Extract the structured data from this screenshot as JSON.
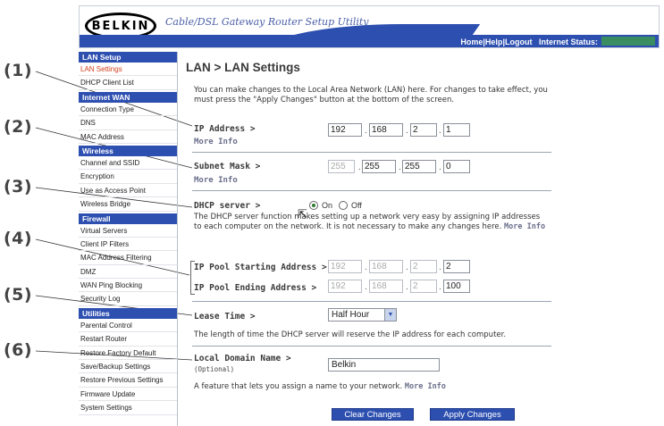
{
  "callouts": [
    "(1)",
    "(2)",
    "(3)",
    "(4)",
    "(5)",
    "(6)"
  ],
  "header": {
    "logo": "BELKIN",
    "title": "Cable/DSL Gateway Router Setup Utility",
    "links": {
      "home": "Home",
      "help": "Help",
      "logout": "Logout",
      "status": "Internet Status:"
    },
    "sep": "|"
  },
  "sidebar": {
    "lan_setup": {
      "title": "LAN Setup",
      "items": [
        "LAN Settings",
        "DHCP Client List"
      ]
    },
    "internet_wan": {
      "title": "Internet WAN",
      "items": [
        "Connection Type",
        "DNS",
        "MAC Address"
      ]
    },
    "wireless": {
      "title": "Wireless",
      "items": [
        "Channel and SSID",
        "Encryption",
        "Use as Access Point",
        "Wireless Bridge"
      ]
    },
    "firewall": {
      "title": "Firewall",
      "items": [
        "Virtual Servers",
        "Client IP Filters",
        "MAC Address Filtering",
        "DMZ",
        "WAN Ping Blocking",
        "Security Log"
      ]
    },
    "utilities": {
      "title": "Utilities",
      "items": [
        "Parental Control",
        "Restart Router",
        "Restore Factory Default",
        "Save/Backup Settings",
        "Restore Previous Settings",
        "Firmware Update",
        "System Settings"
      ]
    }
  },
  "main": {
    "title": "LAN > LAN Settings",
    "intro": "You can make changes to the Local Area Network (LAN) here. For changes to take effect, you must press the \"Apply Changes\" button at the bottom of the screen.",
    "ip_address": {
      "label": "IP Address >",
      "more": "More Info",
      "octets": [
        "192",
        "168",
        "2",
        "1"
      ]
    },
    "subnet_mask": {
      "label": "Subnet Mask >",
      "more": "More Info",
      "octets": [
        "255",
        "255",
        "255",
        "0"
      ]
    },
    "dhcp": {
      "label": "DHCP server >",
      "on": "On",
      "off": "Off",
      "desc": "The DHCP server function makes setting up a network very easy by assigning IP addresses to each computer on the network. It is not necessary to make any changes here.",
      "more": "More Info"
    },
    "pool_start": {
      "label": "IP Pool Starting Address >",
      "octets": [
        "192",
        "168",
        "2",
        "2"
      ]
    },
    "pool_end": {
      "label": "IP Pool Ending Address >",
      "octets": [
        "192",
        "168",
        "2",
        "100"
      ]
    },
    "lease": {
      "label": "Lease Time >",
      "value": "Half Hour",
      "desc": "The length of time the DHCP server will reserve the IP address for each computer."
    },
    "domain": {
      "label": "Local Domain Name >",
      "optional": "(Optional)",
      "value": "Belkin",
      "desc": "A feature that lets you assign a name to your network.",
      "more": "More Info"
    },
    "buttons": {
      "clear": "Clear Changes",
      "apply": "Apply Changes"
    }
  },
  "colors": {
    "accent": "#2d4fb0",
    "active": "#d0421e",
    "more_info": "#6a6e8a"
  }
}
